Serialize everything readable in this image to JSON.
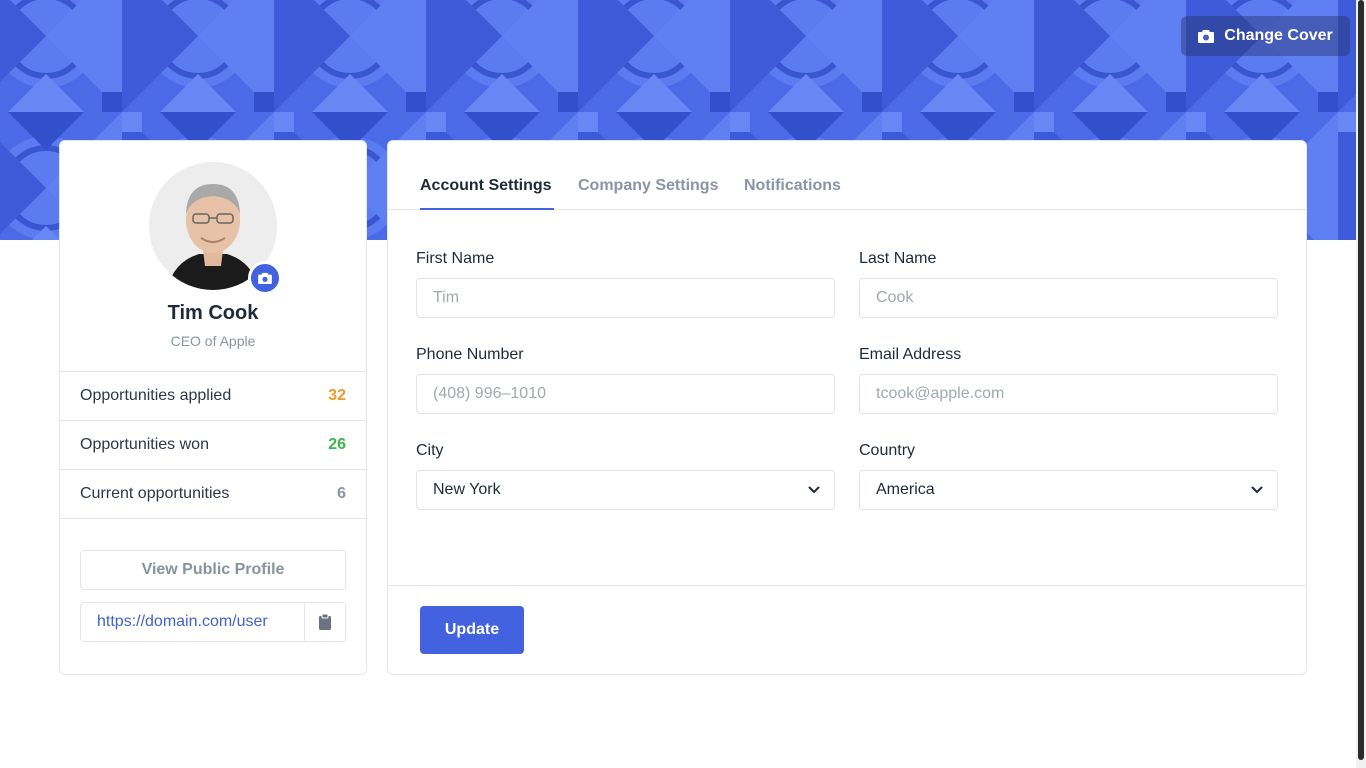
{
  "cover": {
    "change_label": "Change Cover",
    "icon": "camera-icon",
    "color": "#4a6ae8"
  },
  "profile": {
    "name": "Tim Cook",
    "role": "CEO of Apple",
    "avatar_badge_icon": "camera-icon",
    "stats": [
      {
        "label": "Opportunities applied",
        "value": "32",
        "color": "#ec9b2b"
      },
      {
        "label": "Opportunities won",
        "value": "26",
        "color": "#3cb54a"
      },
      {
        "label": "Current opportunities",
        "value": "6",
        "color": "#8a94a6"
      }
    ],
    "view_public_label": "View Public Profile",
    "public_url": "https://domain.com/user",
    "copy_icon": "clipboard-icon"
  },
  "tabs": [
    {
      "label": "Account Settings",
      "active": true
    },
    {
      "label": "Company Settings",
      "active": false
    },
    {
      "label": "Notifications",
      "active": false
    }
  ],
  "form": {
    "first_name": {
      "label": "First Name",
      "placeholder": "Tim"
    },
    "last_name": {
      "label": "Last Name",
      "placeholder": "Cook"
    },
    "phone": {
      "label": "Phone Number",
      "placeholder": "(408) 996–1010"
    },
    "email": {
      "label": "Email Address",
      "placeholder": "tcook@apple.com"
    },
    "city": {
      "label": "City",
      "value": "New York"
    },
    "country": {
      "label": "Country",
      "value": "America"
    },
    "update_label": "Update"
  },
  "accent_color": "#4262e0"
}
